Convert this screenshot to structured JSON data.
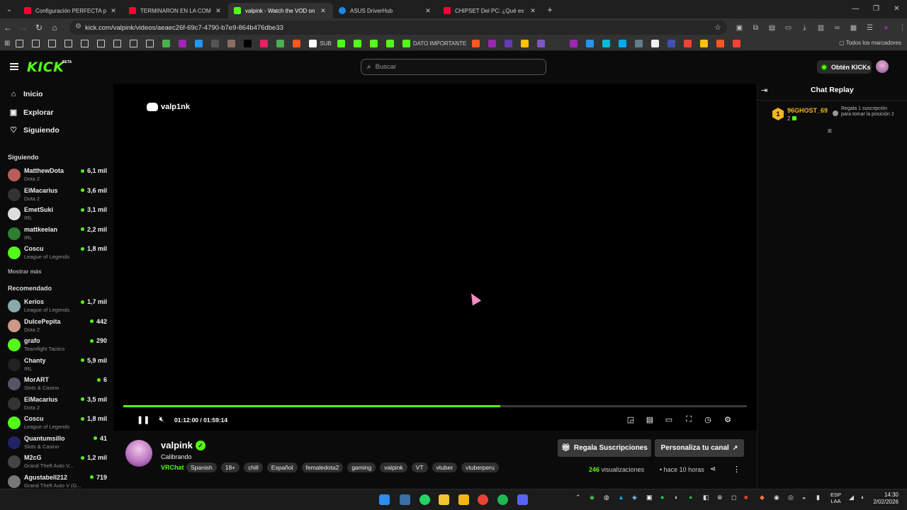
{
  "browser": {
    "tabs": [
      {
        "title": "Configuración PERFECTA para l",
        "color": "#ff0033"
      },
      {
        "title": "TERMINARON EN LA COMISAR",
        "color": "#ff0033"
      },
      {
        "title": "valpink - Watch the VOD on Ki",
        "color": "#53fc18"
      },
      {
        "title": "ASUS DriverHub",
        "color": "#1e88e5"
      },
      {
        "title": "CHIPSET Del PC: ¿Qué es y Para",
        "color": "#ff0033"
      }
    ],
    "url": "kick.com/valpink/videos/aeaec26f-69c7-4790-b7e9-864b476dbe33",
    "bookmarks": [
      {
        "label": "",
        "color": "#e0b000"
      },
      {
        "label": "",
        "color": "#e0b000"
      },
      {
        "label": "",
        "color": "#e0b000"
      },
      {
        "label": "",
        "color": "#e0b000"
      },
      {
        "label": "",
        "color": "#e0b000"
      },
      {
        "label": "",
        "color": "#e0b000"
      },
      {
        "label": "",
        "color": "#e0b000"
      },
      {
        "label": "",
        "color": "#e0b000"
      },
      {
        "label": "",
        "color": "#e0b000"
      },
      {
        "label": "",
        "color": "#4caf50"
      },
      {
        "label": "",
        "color": "#9c27b0"
      },
      {
        "label": "",
        "color": "#2196f3"
      },
      {
        "label": "",
        "color": "#555"
      },
      {
        "label": "",
        "color": "#8d6e63"
      },
      {
        "label": "",
        "color": "#000"
      },
      {
        "label": "",
        "color": "#e91e63"
      },
      {
        "label": "",
        "color": "#4caf50"
      },
      {
        "label": "",
        "color": "#ff5722"
      },
      {
        "label": "SUB",
        "color": "#fff"
      },
      {
        "label": "",
        "color": "#53fc18"
      },
      {
        "label": "",
        "color": "#53fc18"
      },
      {
        "label": "",
        "color": "#53fc18"
      },
      {
        "label": "",
        "color": "#53fc18"
      },
      {
        "label": "DATO IMPORTANTE",
        "color": "#53fc18"
      },
      {
        "label": "",
        "color": "#ff5722"
      },
      {
        "label": "",
        "color": "#9c27b0"
      },
      {
        "label": "",
        "color": "#673ab7"
      },
      {
        "label": "",
        "color": "#ffc107"
      },
      {
        "label": "",
        "color": "#7e57c2"
      },
      {
        "label": "",
        "color": "#333"
      },
      {
        "label": "",
        "color": "#9c27b0"
      },
      {
        "label": "",
        "color": "#2196f3"
      },
      {
        "label": "",
        "color": "#00bcd4"
      },
      {
        "label": "",
        "color": "#03a9f4"
      },
      {
        "label": "",
        "color": "#607d8b"
      },
      {
        "label": "",
        "color": "#eee"
      },
      {
        "label": "",
        "color": "#3f51b5"
      },
      {
        "label": "",
        "color": "#f44336"
      },
      {
        "label": "",
        "color": "#ffc107"
      },
      {
        "label": "",
        "color": "#ff5722"
      },
      {
        "label": "",
        "color": "#f44336"
      }
    ],
    "bookmarks_right": "Todos los marcadores"
  },
  "kick": {
    "logo": "KICK",
    "beta": "BETA",
    "search_placeholder": "Buscar",
    "kicks_button": "Obtén KICKs",
    "nav": [
      "Inicio",
      "Explorar",
      "Siguiendo"
    ],
    "following_header": "Siguiendo",
    "following": [
      {
        "name": "MatthewDota",
        "game": "Dota 2",
        "viewers": "6,1 mil",
        "color": "#b85c5c"
      },
      {
        "name": "ElMacarius",
        "game": "Dota 2",
        "viewers": "3,6 mil",
        "color": "#333"
      },
      {
        "name": "EmetSuki",
        "game": "IRL",
        "viewers": "3,1 mil",
        "color": "#ddd"
      },
      {
        "name": "mattkeelan",
        "game": "IRL",
        "viewers": "2,2 mil",
        "color": "#2e7d32"
      },
      {
        "name": "Coscu",
        "game": "League of Legends",
        "viewers": "1,8 mil",
        "color": "#53fc18"
      }
    ],
    "show_more": "Mostrar más",
    "recommended_header": "Recomendado",
    "recommended": [
      {
        "name": "Kerios",
        "game": "League of Legends",
        "viewers": "1,7 mil",
        "color": "#8aa"
      },
      {
        "name": "DulcePepita",
        "game": "Dota 2",
        "viewers": "442",
        "color": "#c98"
      },
      {
        "name": "grafo",
        "game": "Teamfight Tactics",
        "viewers": "290",
        "color": "#53fc18"
      },
      {
        "name": "Chanty",
        "game": "IRL",
        "viewers": "5,9 mil",
        "color": "#222"
      },
      {
        "name": "MorART",
        "game": "Slots & Casino",
        "viewers": "6",
        "color": "#556"
      },
      {
        "name": "ElMacarius",
        "game": "Dota 2",
        "viewers": "3,5 mil",
        "color": "#333"
      },
      {
        "name": "Coscu",
        "game": "League of Legends",
        "viewers": "1,8 mil",
        "color": "#53fc18"
      },
      {
        "name": "Quantumsillo",
        "game": "Slots & Casino",
        "viewers": "41",
        "color": "#226"
      },
      {
        "name": "M2cG",
        "game": "Grand Theft Auto V...",
        "viewers": "1,2 mil",
        "color": "#444"
      },
      {
        "name": "Agustabell212",
        "game": "Grand Theft Auto V (G...",
        "viewers": "719",
        "color": "#777"
      }
    ]
  },
  "player": {
    "overlay_brand": "valp1nk",
    "time": "01:12:00 / 01:59:14",
    "progress": 0.604
  },
  "stream": {
    "name": "valpink",
    "title": "Calibrando",
    "category": "VRChat",
    "tags": [
      "Spanish",
      "18+",
      "chill",
      "Español",
      "femaledota2",
      "gaming",
      "valpink",
      "VT",
      "vtuber",
      "vtuberperu"
    ],
    "gift_button": "Regala Suscripciones",
    "customize_button": "Personaliza tu canal",
    "views_count": "246",
    "views_label": "visualizaciones",
    "ago": "hace 10 horas"
  },
  "chat": {
    "title": "Chat Replay",
    "top_gifter_rank": "1",
    "top_gifter_name": "96GHOST_69",
    "top_gifter_count": "2",
    "gift_prompt": "Regala 1 suscripción para tomar la posición 2"
  },
  "taskbar": {
    "lang_top": "ESP",
    "lang_bottom": "LAA",
    "time": "14:30",
    "date": "2/02/2026"
  }
}
